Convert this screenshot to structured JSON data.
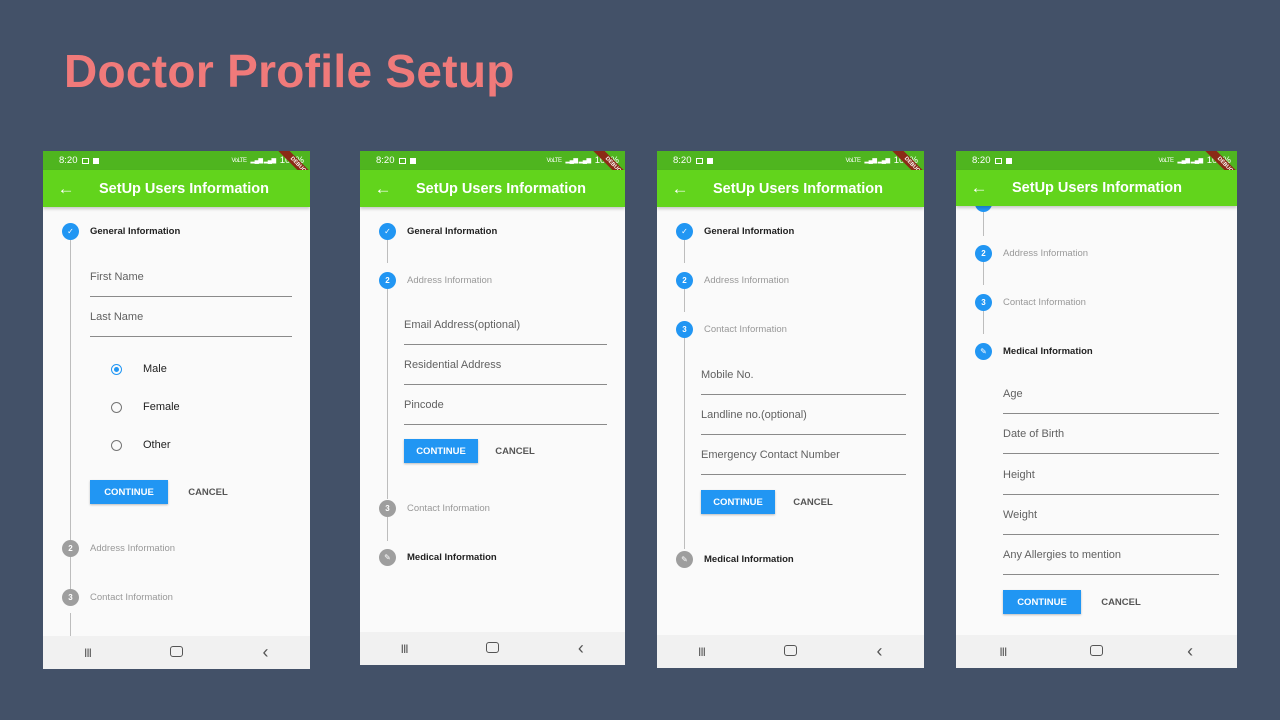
{
  "page_title": "Doctor Profile Setup",
  "status_time": "8:20",
  "status_battery": "100%",
  "status_signal": "VoLTE",
  "debug_label": "DEBUG",
  "appbar_title": "SetUp Users Information",
  "steps": {
    "general": "General Information",
    "address": "Address Information",
    "contact": "Contact Information",
    "medical": "Medical Information"
  },
  "step_numbers": {
    "address": "2",
    "contact": "3"
  },
  "buttons": {
    "continue": "CONTINUE",
    "cancel": "CANCEL"
  },
  "screen1": {
    "fields": [
      "First Name",
      "Last Name"
    ],
    "gender_options": [
      "Male",
      "Female",
      "Other"
    ],
    "selected_gender": "Male"
  },
  "screen2": {
    "fields": [
      "Email Address(optional)",
      "Residential Address",
      "Pincode"
    ]
  },
  "screen3": {
    "fields": [
      "Mobile No.",
      "Landline no.(optional)",
      "Emergency Contact Number"
    ]
  },
  "screen4": {
    "fields": [
      "Age",
      "Date of Birth",
      "Height",
      "Weight",
      "Any Allergies to mention"
    ]
  },
  "colors": {
    "background": "#435168",
    "title": "#f07a7a",
    "appbar": "#62d41c",
    "statusbar": "#4fb51f",
    "accent": "#2196f3",
    "inactive_step": "#9e9e9e"
  }
}
